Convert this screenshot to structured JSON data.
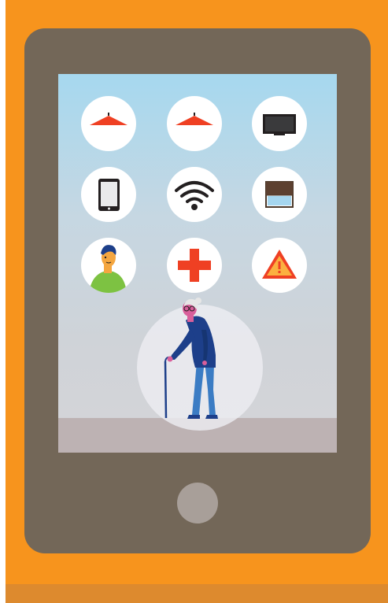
{
  "device": {
    "type": "tablet",
    "frame_color": "#f7941d",
    "body_color": "#736758",
    "home_button_color": "#a89f99"
  },
  "screen": {
    "sky_color": "#a6d8ef",
    "floor_color": "#bdb2b3",
    "tiles": [
      {
        "name": "ceiling-lamp-1-icon"
      },
      {
        "name": "ceiling-lamp-2-icon"
      },
      {
        "name": "television-icon"
      },
      {
        "name": "smartphone-icon"
      },
      {
        "name": "wifi-icon"
      },
      {
        "name": "window-blind-icon"
      },
      {
        "name": "caregiver-avatar-icon"
      },
      {
        "name": "medical-cross-icon"
      },
      {
        "name": "warning-alert-icon"
      }
    ],
    "person": {
      "name": "elderly-woman-with-cane"
    }
  },
  "colors": {
    "accent_red": "#ef4023",
    "warning_yellow": "#fbb040",
    "figure_blue": "#1d3f8a"
  }
}
